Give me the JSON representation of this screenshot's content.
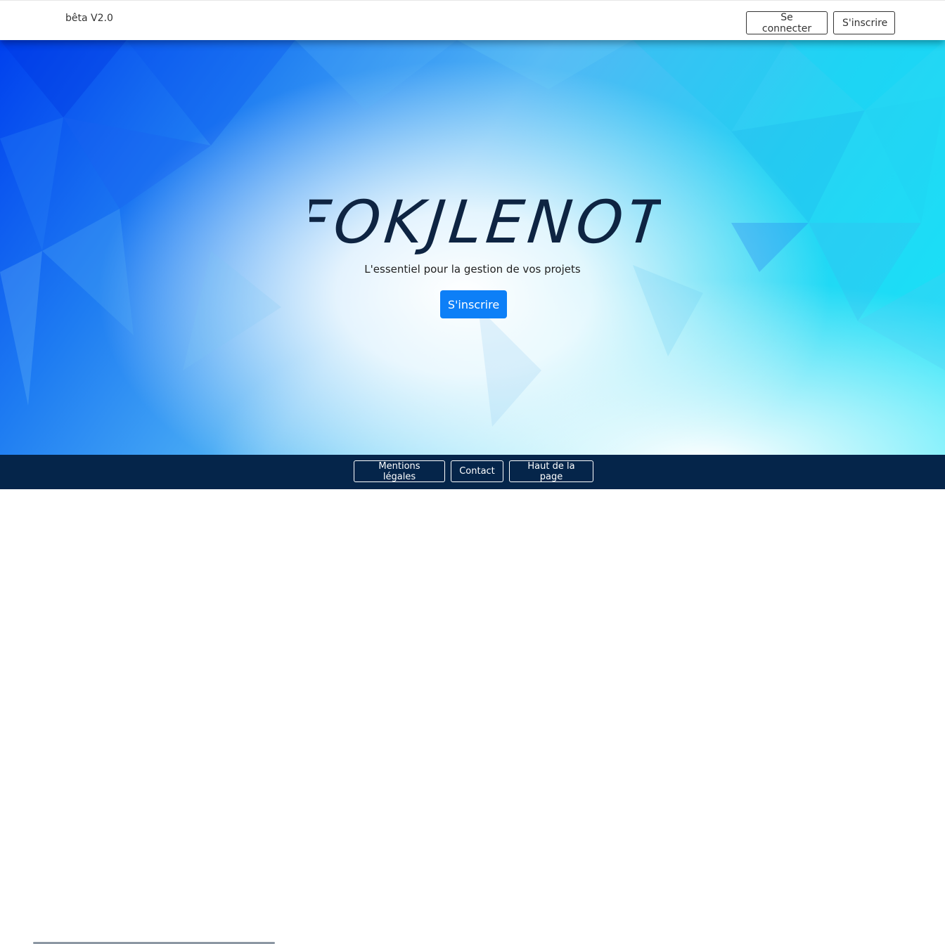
{
  "navbar": {
    "brand": "bêta V2.0",
    "login_label": "Se connecter",
    "signup_label": "S'inscrire"
  },
  "hero": {
    "logo_text": "FOKJLENOT",
    "tagline": "L'essentiel pour la gestion de vos projets",
    "cta_label": "S'inscrire"
  },
  "footer": {
    "links": [
      "Mentions légales",
      "Contact",
      "Haut de la page"
    ]
  },
  "colors": {
    "primary": "#0d7ff7",
    "footer_bg": "#05254a",
    "logo": "#0e2442"
  }
}
